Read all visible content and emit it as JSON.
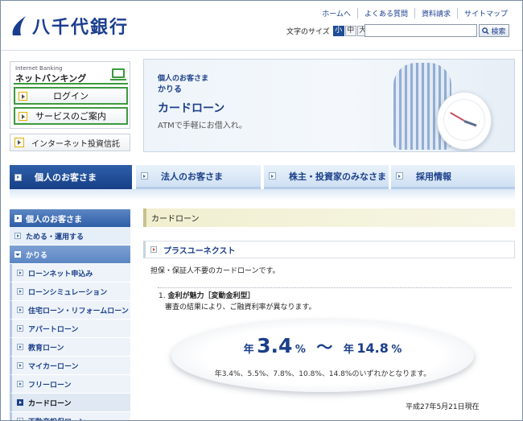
{
  "header": {
    "bank_name": "八千代銀行",
    "top_links": [
      "ホームへ",
      "よくある質問",
      "資料請求",
      "サイトマップ"
    ],
    "font_size_label": "文字のサイズ",
    "font_sizes": [
      "小",
      "中",
      "大"
    ],
    "search_placeholder": "",
    "search_button": "検索"
  },
  "internet_banking": {
    "small_label": "Internet Banking",
    "title": "ネットバンキング",
    "login_button": "ログイン",
    "service_button": "サービスのご案内",
    "invest_button": "インターネット投資信託"
  },
  "banner": {
    "audience": "個人のお客さま",
    "category": "かりる",
    "title": "カードローン",
    "description": "ATMで手軽にお借入れ。"
  },
  "nav": {
    "tabs": [
      "個人のお客さま",
      "法人のお客さま",
      "株主・投資家のみなさま",
      "採用情報"
    ]
  },
  "sidebar": {
    "head": "個人のお客さま",
    "items": [
      {
        "label": "ためる・運用する",
        "level": "l1"
      },
      {
        "label": "かりる",
        "level": "l1-open"
      },
      {
        "label": "ローンネット申込み",
        "level": "l2"
      },
      {
        "label": "ローンシミュレーション",
        "level": "l2"
      },
      {
        "label": "住宅ローン・リフォームローン",
        "level": "l2"
      },
      {
        "label": "アパートローン",
        "level": "l2"
      },
      {
        "label": "教育ローン",
        "level": "l2"
      },
      {
        "label": "マイカーローン",
        "level": "l2"
      },
      {
        "label": "フリーローン",
        "level": "l2"
      },
      {
        "label": "カードローン",
        "level": "l2-current"
      },
      {
        "label": "不動産担保ローン",
        "level": "l2"
      }
    ]
  },
  "content": {
    "page_title": "カードローン",
    "section_title": "プラスユーネクスト",
    "lead": "担保・保証人不要のカードローンです。",
    "point_number": "1.",
    "point_title": "金利が魅力［変動金利型］",
    "point_desc": "審査の結果により、ご融資利率が異なります。",
    "rate": {
      "year1": "年",
      "low": "3.4",
      "pct1": "%",
      "tilde": "〜",
      "year2": "年",
      "high": "14.8",
      "pct2": "%",
      "note": "年3.4%、5.5%、7.8%、10.8%、14.8%のいずれかとなります。"
    },
    "as_of": "平成27年5月21日現在"
  }
}
